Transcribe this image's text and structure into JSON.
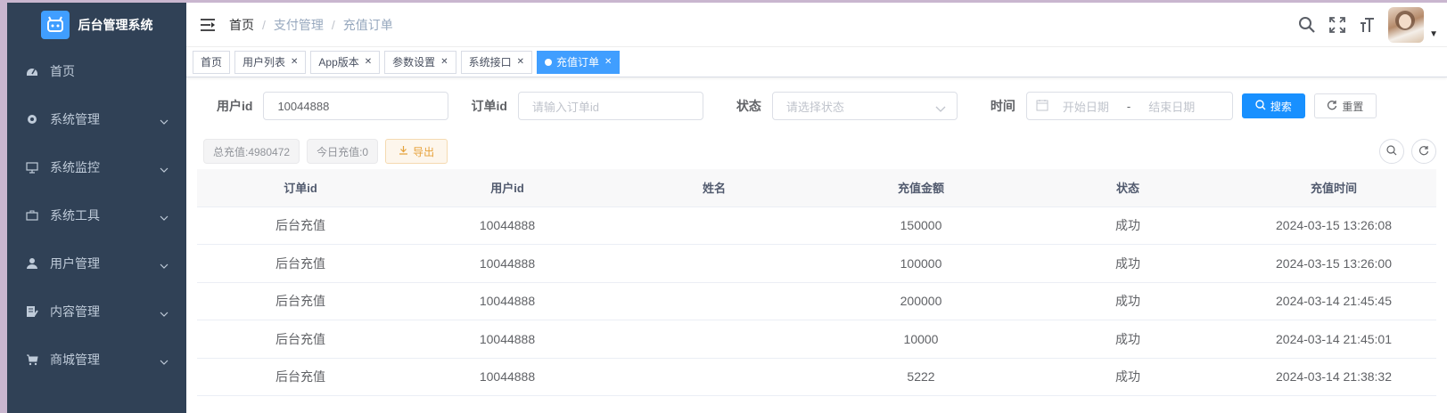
{
  "app": {
    "title": "后台管理系统"
  },
  "sidebar": {
    "items": [
      {
        "label": "首页",
        "icon": "dashboard-icon",
        "expandable": false
      },
      {
        "label": "系统管理",
        "icon": "gear-icon",
        "expandable": true
      },
      {
        "label": "系统监控",
        "icon": "monitor-icon",
        "expandable": true
      },
      {
        "label": "系统工具",
        "icon": "toolbox-icon",
        "expandable": true
      },
      {
        "label": "用户管理",
        "icon": "user-icon",
        "expandable": true
      },
      {
        "label": "内容管理",
        "icon": "document-edit-icon",
        "expandable": true
      },
      {
        "label": "商城管理",
        "icon": "cart-icon",
        "expandable": true
      }
    ]
  },
  "navbar": {
    "breadcrumb": [
      "首页",
      "支付管理",
      "充值订单"
    ],
    "separator": "/"
  },
  "tags": [
    {
      "label": "首页",
      "closable": false,
      "active": false
    },
    {
      "label": "用户列表",
      "closable": true,
      "active": false
    },
    {
      "label": "App版本",
      "closable": true,
      "active": false
    },
    {
      "label": "参数设置",
      "closable": true,
      "active": false
    },
    {
      "label": "系统接口",
      "closable": true,
      "active": false
    },
    {
      "label": "充值订单",
      "closable": true,
      "active": true
    }
  ],
  "filter": {
    "user_id_label": "用户id",
    "user_id_value": "10044888",
    "order_id_label": "订单id",
    "order_id_placeholder": "请输入订单id",
    "status_label": "状态",
    "status_placeholder": "请选择状态",
    "time_label": "时间",
    "start_placeholder": "开始日期",
    "range_sep": "-",
    "end_placeholder": "结束日期",
    "search_label": "搜索",
    "reset_label": "重置"
  },
  "toolbar": {
    "total_recharge": "总充值:4980472",
    "today_recharge": "今日充值:0",
    "export_label": "导出"
  },
  "table": {
    "columns": [
      "订单id",
      "用户id",
      "姓名",
      "充值金额",
      "状态",
      "充值时间"
    ],
    "rows": [
      [
        "后台充值",
        "10044888",
        "",
        "150000",
        "成功",
        "2024-03-15 13:26:08"
      ],
      [
        "后台充值",
        "10044888",
        "",
        "100000",
        "成功",
        "2024-03-15 13:26:00"
      ],
      [
        "后台充值",
        "10044888",
        "",
        "200000",
        "成功",
        "2024-03-14 21:45:45"
      ],
      [
        "后台充值",
        "10044888",
        "",
        "10000",
        "成功",
        "2024-03-14 21:45:01"
      ],
      [
        "后台充值",
        "10044888",
        "",
        "5222",
        "成功",
        "2024-03-14 21:38:32"
      ]
    ]
  },
  "colors": {
    "sidebar_bg": "#304156",
    "primary": "#1890ff",
    "tag_active": "#409eff",
    "warning": "#e6a23c"
  }
}
